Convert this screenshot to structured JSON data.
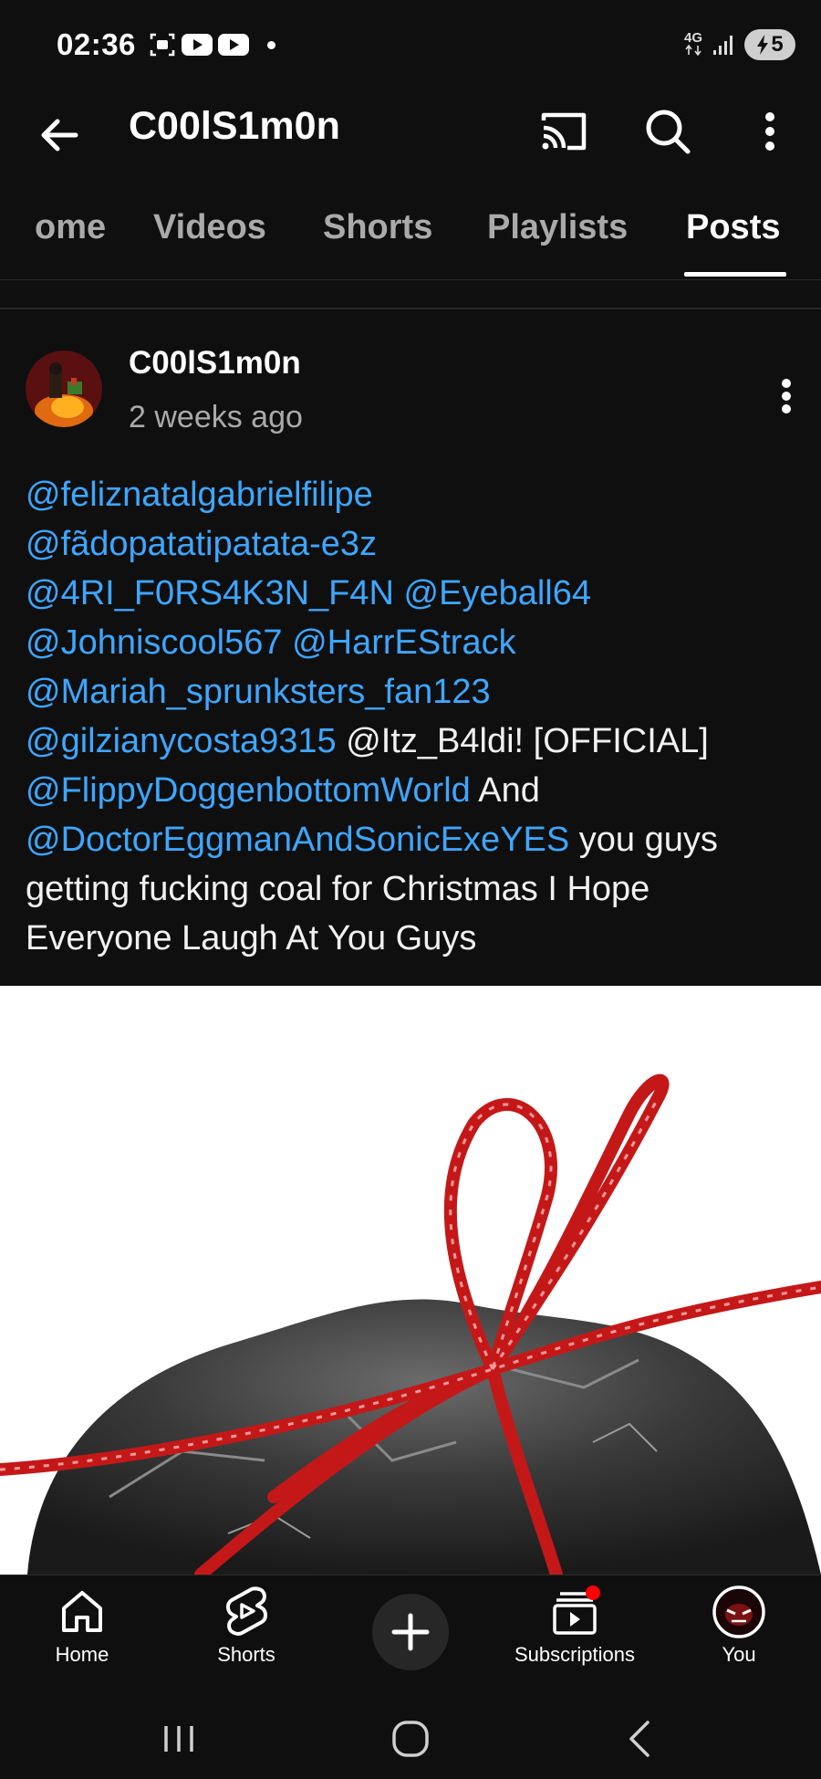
{
  "status_bar": {
    "time": "02:36",
    "network": "4G",
    "battery_level": "5"
  },
  "app_bar": {
    "channel_name": "C00lS1m0n"
  },
  "tabs": [
    {
      "label": "Home",
      "visible_label": "ome",
      "active": false
    },
    {
      "label": "Videos",
      "active": false
    },
    {
      "label": "Shorts",
      "active": false
    },
    {
      "label": "Playlists",
      "active": false
    },
    {
      "label": "Posts",
      "active": true
    }
  ],
  "post": {
    "author": "C00lS1m0n",
    "time": "2 weeks ago",
    "text_lines": [
      [
        {
          "t": "@feliznatalgabrielfilipe",
          "m": true
        }
      ],
      [
        {
          "t": "@fãdopatatipatata-e3z",
          "m": true
        }
      ],
      [
        {
          "t": "@4RI_F0RS4K3N_F4N",
          "m": true
        },
        {
          "t": " ",
          "m": false
        },
        {
          "t": "@Eyeball64",
          "m": true
        }
      ],
      [
        {
          "t": "@Johniscool567",
          "m": true
        },
        {
          "t": " ",
          "m": false
        },
        {
          "t": "@HarrEStrack",
          "m": true
        }
      ],
      [
        {
          "t": "@Mariah_sprunksters_fan123",
          "m": true
        }
      ],
      [
        {
          "t": "@gilzianycosta9315",
          "m": true
        },
        {
          "t": " @Itz_B4ldi! [OFFICIAL]",
          "m": false
        }
      ],
      [
        {
          "t": "@FlippyDoggenbottomWorld",
          "m": true
        },
        {
          "t": " And",
          "m": false
        }
      ],
      [
        {
          "t": "@DoctorEggmanAndSonicExeYES",
          "m": true
        },
        {
          "t": " you guys",
          "m": false
        }
      ],
      [
        {
          "t": "getting fucking coal for Christmas I Hope",
          "m": false
        }
      ],
      [
        {
          "t": "Everyone Laugh At You Guys",
          "m": false
        }
      ]
    ],
    "image_description_icon": "coal-with-red-ribbon-image"
  },
  "bottom_nav": {
    "home": "Home",
    "shorts": "Shorts",
    "subscriptions": "Subscriptions",
    "you": "You"
  },
  "colors": {
    "background": "#0f0f0f",
    "mention": "#3ea6ff",
    "secondary_text": "#aaaaaa",
    "notification_dot": "#ff0000"
  }
}
